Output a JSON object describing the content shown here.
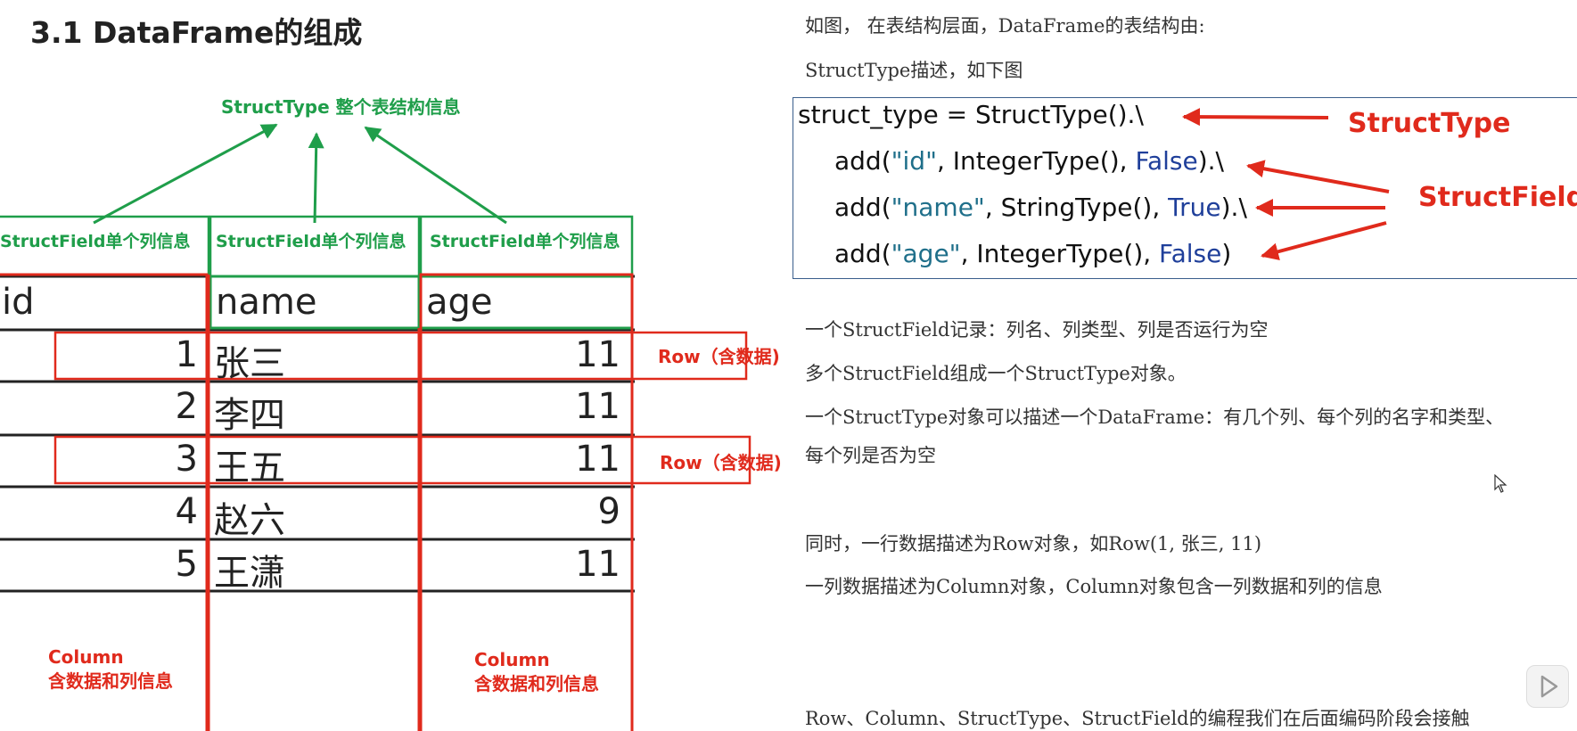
{
  "title": "3.1 DataFrame的组成",
  "diagram": {
    "structtype_label": "StructType 整个表结构信息",
    "structfield_labels": [
      "StructField单个列信息",
      "StructField单个列信息",
      "StructField单个列信息"
    ],
    "headers": [
      "id",
      "name",
      "age"
    ],
    "rows": [
      {
        "id": "1",
        "name": "张三",
        "age": "11"
      },
      {
        "id": "2",
        "name": "李四",
        "age": "11"
      },
      {
        "id": "3",
        "name": "王五",
        "age": "11"
      },
      {
        "id": "4",
        "name": "赵六",
        "age": "9"
      },
      {
        "id": "5",
        "name": "王潇",
        "age": "11"
      }
    ],
    "row_labels": [
      "Row（含数据)",
      "Row（含数据)"
    ],
    "column_labels": [
      {
        "line1": "Column",
        "line2": "含数据和列信息"
      },
      {
        "line1": "Column",
        "line2": "含数据和列信息"
      }
    ]
  },
  "right": {
    "intro_line1": "如图，  在表结构层面，DataFrame的表结构由:",
    "intro_line2": "StructType描述，如下图",
    "code": {
      "line1": "struct_type = StructType().\\",
      "line2": {
        "pre": "add(",
        "str": "\"id\"",
        "mid": ", IntegerType(), ",
        "kw": "False",
        "post": ").\\"
      },
      "line3": {
        "pre": "add(",
        "str": "\"name\"",
        "mid": ", StringType(), ",
        "kw": "True",
        "post": ").\\"
      },
      "line4": {
        "pre": "add(",
        "str": "\"age\"",
        "mid": ", IntegerType(), ",
        "kw": "False",
        "post": ")"
      }
    },
    "code_labels": {
      "structtype": "StructType",
      "structfield": "StructField"
    },
    "paragraphs": [
      "一个StructField记录：列名、列类型、列是否运行为空",
      "多个StructField组成一个StructType对象。",
      "一个StructType对象可以描述一个DataFrame：有几个列、每个列的名字和类型、",
      "每个列是否为空",
      "同时，一行数据描述为Row对象，如Row(1, 张三, 11)",
      "一列数据描述为Column对象，Column对象包含一列数据和列的信息",
      "Row、Column、StructType、StructField的编程我们在后面编码阶段会接触"
    ]
  },
  "colors": {
    "green": "#1f9e4a",
    "red": "#e02a1c",
    "code_border": "#3a5e8c",
    "keyword": "#1f3f9a"
  }
}
